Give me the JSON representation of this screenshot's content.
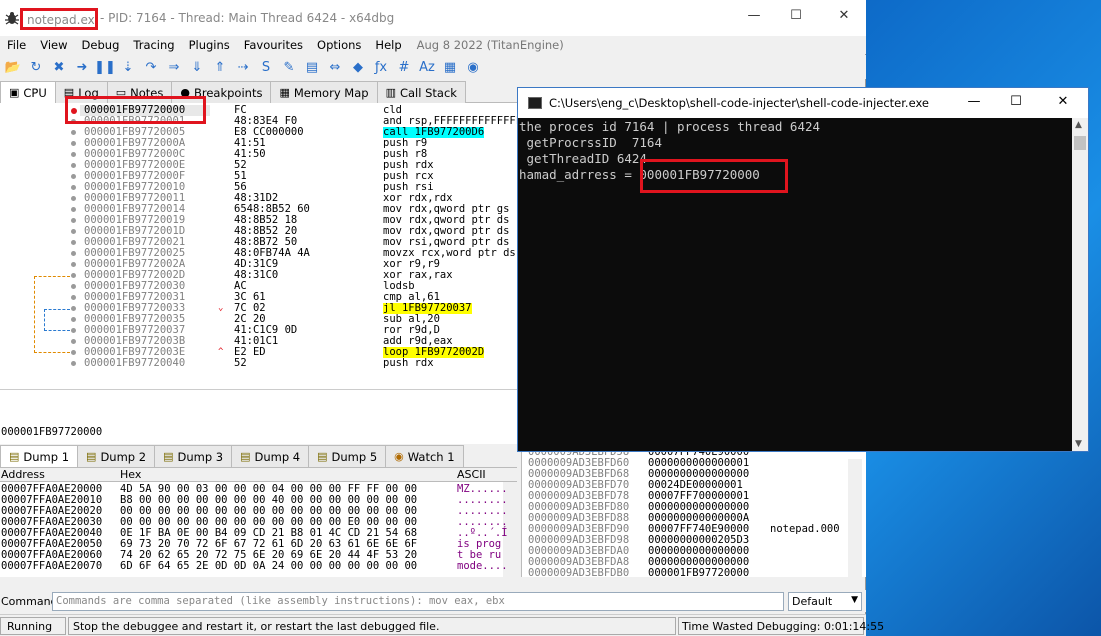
{
  "colors": {
    "highlight_red": "#e0141e",
    "call_cyan": "#00ffff",
    "jump_yellow": "#ffff00",
    "console_bg": "#0c0c0c"
  },
  "titlebar": {
    "process": "notepad.exe",
    "rest": "- PID: 7164 - Thread: Main Thread 6424 - x64dbg",
    "icon": "bug-icon",
    "minimize": "—",
    "maximize": "☐",
    "close": "✕"
  },
  "menu": {
    "items": [
      "File",
      "View",
      "Debug",
      "Tracing",
      "Plugins",
      "Favourites",
      "Options",
      "Help"
    ],
    "date": "Aug 8 2022 (TitanEngine)"
  },
  "toolbar": {
    "icons": [
      "open-icon",
      "restart-icon",
      "close-icon",
      "run-icon",
      "pause-icon",
      "step-into-icon",
      "step-over-icon",
      "trace-into-icon",
      "trace-over-icon",
      "execute-till-return-icon",
      "run-to-user-code-icon",
      "script-icon",
      "patch-icon",
      "comment-icon",
      "label-icon",
      "bookmark-icon",
      "function-icon",
      "hash-icon",
      "font-icon",
      "calculator-icon",
      "help-icon"
    ],
    "glyphs": [
      "📂",
      "↻",
      "✖",
      "➜",
      "❚❚",
      "⇣",
      "↷",
      "⇒",
      "⇓",
      "⇑",
      "⇢",
      "S",
      "✎",
      "▤",
      "⇔",
      "◆",
      "ƒx",
      "#",
      "Aᴢ",
      "▦",
      "◉"
    ]
  },
  "tabs": [
    {
      "label": "CPU",
      "icon": "cpu-icon",
      "glyph": "▣",
      "active": true
    },
    {
      "label": "Log",
      "icon": "log-icon",
      "glyph": "▤",
      "active": false
    },
    {
      "label": "Notes",
      "icon": "notes-icon",
      "glyph": "▭",
      "active": false
    },
    {
      "label": "Breakpoints",
      "icon": "breakpoint-icon",
      "glyph": "●",
      "active": false
    },
    {
      "label": "Memory Map",
      "icon": "memory-map-icon",
      "glyph": "▦",
      "active": false
    },
    {
      "label": "Call Stack",
      "icon": "call-stack-icon",
      "glyph": "▥",
      "active": false
    }
  ],
  "disasm": {
    "rows": [
      {
        "addr": "000001FB97720000",
        "bytes": "FC",
        "instr": "cld",
        "bp": true
      },
      {
        "addr": "000001FB97720001",
        "bytes": "48:83E4 F0",
        "instr": "and rsp,FFFFFFFFFFFFFFF0"
      },
      {
        "addr": "000001FB97720005",
        "bytes": "E8 CC000000",
        "instr": "call 1FB977200D6",
        "kind": "call"
      },
      {
        "addr": "000001FB9772000A",
        "bytes": "41:51",
        "instr": "push r9"
      },
      {
        "addr": "000001FB9772000C",
        "bytes": "41:50",
        "instr": "push r8"
      },
      {
        "addr": "000001FB9772000E",
        "bytes": "52",
        "instr": "push rdx"
      },
      {
        "addr": "000001FB9772000F",
        "bytes": "51",
        "instr": "push rcx"
      },
      {
        "addr": "000001FB97720010",
        "bytes": "56",
        "instr": "push rsi"
      },
      {
        "addr": "000001FB97720011",
        "bytes": "48:31D2",
        "instr": "xor rdx,rdx"
      },
      {
        "addr": "000001FB97720014",
        "bytes": "6548:8B52 60",
        "instr": "mov rdx,qword ptr gs"
      },
      {
        "addr": "000001FB97720019",
        "bytes": "48:8B52 18",
        "instr": "mov rdx,qword ptr ds"
      },
      {
        "addr": "000001FB9772001D",
        "bytes": "48:8B52 20",
        "instr": "mov rdx,qword ptr ds"
      },
      {
        "addr": "000001FB97720021",
        "bytes": "48:8B72 50",
        "instr": "mov rsi,qword ptr ds"
      },
      {
        "addr": "000001FB97720025",
        "bytes": "48:0FB74A 4A",
        "instr": "movzx rcx,word ptr ds"
      },
      {
        "addr": "000001FB9772002A",
        "bytes": "4D:31C9",
        "instr": "xor r9,r9"
      },
      {
        "addr": "000001FB9772002D",
        "bytes": "48:31C0",
        "instr": "xor rax,rax"
      },
      {
        "addr": "000001FB97720030",
        "bytes": "AC",
        "instr": "lodsb"
      },
      {
        "addr": "000001FB97720031",
        "bytes": "3C 61",
        "instr": "cmp al,61"
      },
      {
        "addr": "000001FB97720033",
        "bytes": "7C 02",
        "instr": "jl 1FB97720037",
        "kind": "jump",
        "arrow": "⌄"
      },
      {
        "addr": "000001FB97720035",
        "bytes": "2C 20",
        "instr": "sub al,20"
      },
      {
        "addr": "000001FB97720037",
        "bytes": "41:C1C9 0D",
        "instr": "ror r9d,D"
      },
      {
        "addr": "000001FB9772003B",
        "bytes": "41:01C1",
        "instr": "add r9d,eax"
      },
      {
        "addr": "000001FB9772003E",
        "bytes": "E2 ED",
        "instr": "loop 1FB9772002D",
        "kind": "jump",
        "arrow": "^"
      },
      {
        "addr": "000001FB97720040",
        "bytes": "52",
        "instr": "push rdx"
      }
    ],
    "info_address": "000001FB97720000"
  },
  "dump": {
    "tabs": [
      {
        "label": "Dump 1",
        "icon": "dump-icon",
        "active": true
      },
      {
        "label": "Dump 2",
        "icon": "dump-icon",
        "active": false
      },
      {
        "label": "Dump 3",
        "icon": "dump-icon",
        "active": false
      },
      {
        "label": "Dump 4",
        "icon": "dump-icon",
        "active": false
      },
      {
        "label": "Dump 5",
        "icon": "dump-icon",
        "active": false
      },
      {
        "label": "Watch 1",
        "icon": "watch-icon",
        "active": false
      }
    ],
    "headers": {
      "address": "Address",
      "hex": "Hex",
      "ascii": "ASCII"
    },
    "rows": [
      {
        "addr": "00007FFA0AE20000",
        "hex": "4D 5A 90 00 03 00 00 00 04 00 00 00 FF FF 00 00",
        "ascii": "MZ......"
      },
      {
        "addr": "00007FFA0AE20010",
        "hex": "B8 00 00 00 00 00 00 00 40 00 00 00 00 00 00 00",
        "ascii": "........"
      },
      {
        "addr": "00007FFA0AE20020",
        "hex": "00 00 00 00 00 00 00 00 00 00 00 00 00 00 00 00",
        "ascii": "........"
      },
      {
        "addr": "00007FFA0AE20030",
        "hex": "00 00 00 00 00 00 00 00 00 00 00 00 E0 00 00 00",
        "ascii": "........"
      },
      {
        "addr": "00007FFA0AE20040",
        "hex": "0E 1F BA 0E 00 B4 09 CD 21 B8 01 4C CD 21 54 68",
        "ascii": "..º..´.Í"
      },
      {
        "addr": "00007FFA0AE20050",
        "hex": "69 73 20 70 72 6F 67 72 61 6D 20 63 61 6E 6E 6F",
        "ascii": "is prog"
      },
      {
        "addr": "00007FFA0AE20060",
        "hex": "74 20 62 65 20 72 75 6E 20 69 6E 20 44 4F 53 20",
        "ascii": "t be ru"
      },
      {
        "addr": "00007FFA0AE20070",
        "hex": "6D 6F 64 65 2E 0D 0D 0A 24 00 00 00 00 00 00 00",
        "ascii": "mode...."
      }
    ]
  },
  "stack": {
    "rows": [
      {
        "addr": "0000009AD3EBFD58",
        "value": "00007FF740E90000",
        "comment": ""
      },
      {
        "addr": "0000009AD3EBFD60",
        "value": "0000000000000001",
        "comment": ""
      },
      {
        "addr": "0000009AD3EBFD68",
        "value": "0000000000000000",
        "comment": ""
      },
      {
        "addr": "0000009AD3EBFD70",
        "value": "00024DE00000001",
        "comment": ""
      },
      {
        "addr": "0000009AD3EBFD78",
        "value": "00007FF700000001",
        "comment": ""
      },
      {
        "addr": "0000009AD3EBFD80",
        "value": "0000000000000000",
        "comment": ""
      },
      {
        "addr": "0000009AD3EBFD88",
        "value": "000000000000000A",
        "comment": ""
      },
      {
        "addr": "0000009AD3EBFD90",
        "value": "00007FF740E90000",
        "comment": "notepad.000"
      },
      {
        "addr": "0000009AD3EBFD98",
        "value": "00000000000205D3",
        "comment": ""
      },
      {
        "addr": "0000009AD3EBFDA0",
        "value": "0000000000000000",
        "comment": ""
      },
      {
        "addr": "0000009AD3EBFDA8",
        "value": "0000000000000000",
        "comment": ""
      },
      {
        "addr": "0000009AD3EBFDB0",
        "value": "000001FB97720000",
        "comment": ""
      }
    ]
  },
  "command": {
    "label": "Command:",
    "placeholder": "Commands are comma separated (like assembly instructions): mov eax, ebx",
    "mode": "Default"
  },
  "status": {
    "state": "Running",
    "message": "Stop the debuggee and restart it, or restart the last debugged file.",
    "time": "Time Wasted Debugging: 0:01:14:55"
  },
  "console": {
    "title": "C:\\Users\\eng_c\\Desktop\\shell-code-injecter\\shell-code-injecter.exe",
    "minimize": "—",
    "maximize": "☐",
    "close": "✕",
    "lines": [
      "the proces id 7164 | process thread 6424",
      " getProcrssID  7164",
      " getThreadID 6424",
      "hamad_adrress = 000001FB97720000"
    ]
  }
}
